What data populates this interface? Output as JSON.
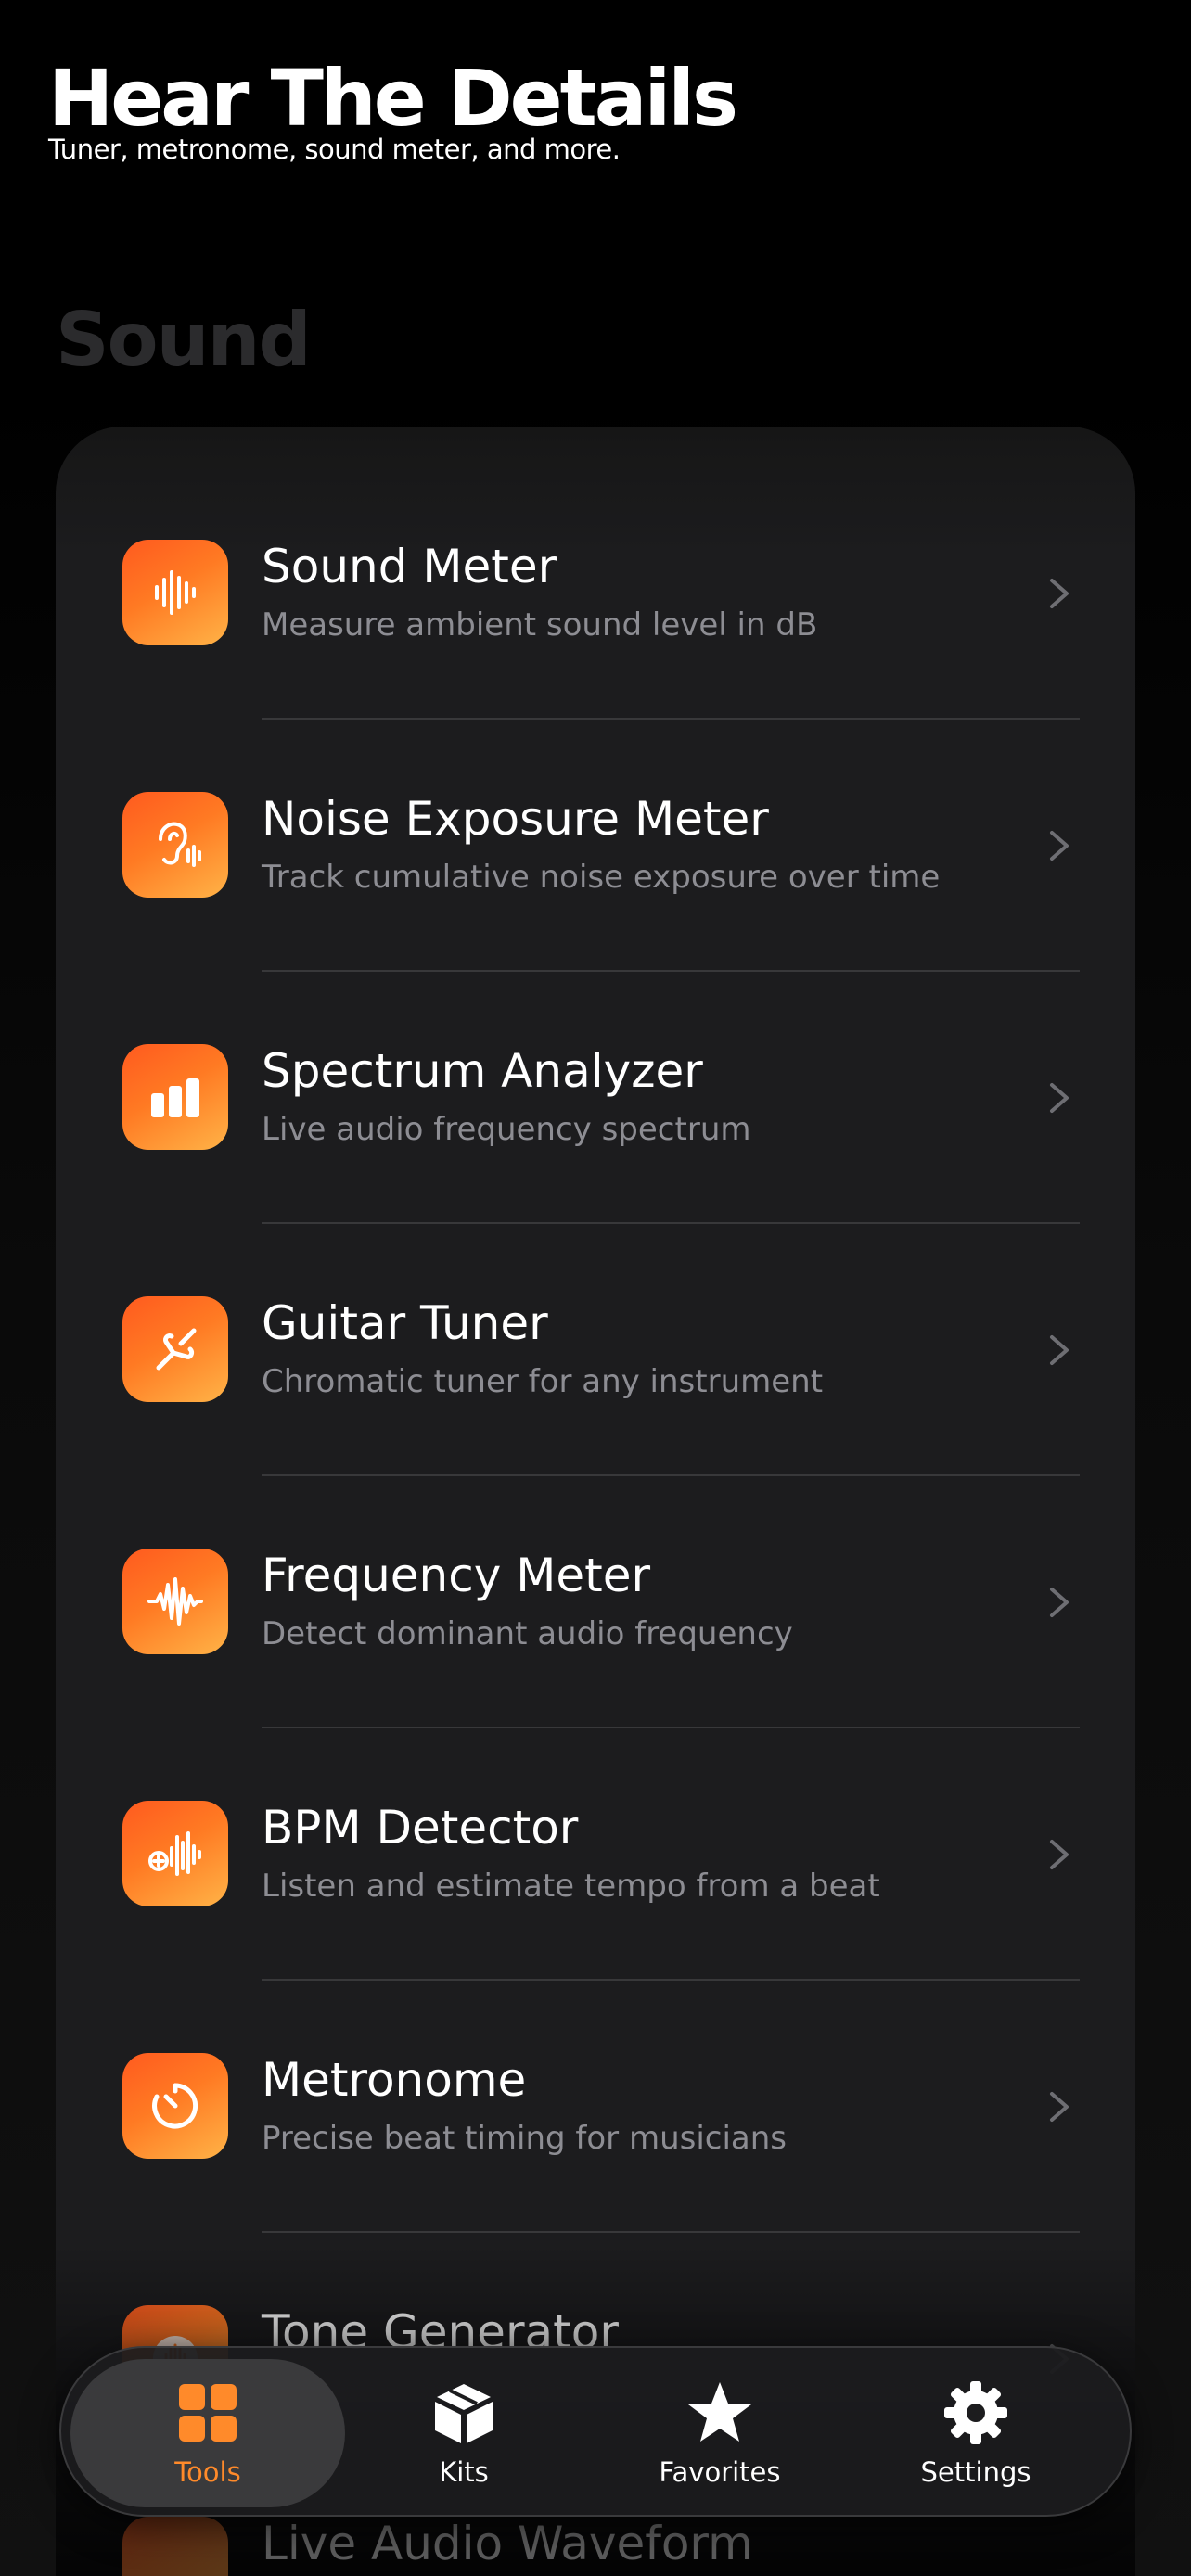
{
  "header": {
    "title": "Hear The Details",
    "subtitle": "Tuner, metronome, sound meter, and more."
  },
  "section": {
    "title": "Sound"
  },
  "tools": [
    {
      "title": "Sound Meter",
      "subtitle": "Measure ambient sound level in dB",
      "icon": "waveform-icon"
    },
    {
      "title": "Noise Exposure Meter",
      "subtitle": "Track cumulative noise exposure over time",
      "icon": "ear-waveform-icon"
    },
    {
      "title": "Spectrum Analyzer",
      "subtitle": "Live audio frequency spectrum",
      "icon": "bar-chart-icon"
    },
    {
      "title": "Guitar Tuner",
      "subtitle": "Chromatic tuner for any instrument",
      "icon": "tuning-fork-icon"
    },
    {
      "title": "Frequency Meter",
      "subtitle": "Detect dominant audio frequency",
      "icon": "wave-spike-icon"
    },
    {
      "title": "BPM Detector",
      "subtitle": "Listen and estimate tempo from a beat",
      "icon": "waveform-plus-icon"
    },
    {
      "title": "Metronome",
      "subtitle": "Precise beat timing for musicians",
      "icon": "timer-icon"
    },
    {
      "title": "Tone Generator",
      "subtitle": "",
      "icon": "waveform-circle-icon"
    }
  ],
  "next_item": {
    "title": "Live Audio Waveform"
  },
  "tabbar": {
    "tabs": [
      {
        "label": "Tools",
        "icon": "grid-icon",
        "active": true
      },
      {
        "label": "Kits",
        "icon": "box-icon",
        "active": false
      },
      {
        "label": "Favorites",
        "icon": "star-icon",
        "active": false
      },
      {
        "label": "Settings",
        "icon": "gear-icon",
        "active": false
      }
    ]
  },
  "colors": {
    "accent": "#ff8a2a",
    "icon_gradient_start": "#ff5a1f",
    "icon_gradient_end": "#ffb347",
    "card_bg": "#1c1c1e"
  }
}
